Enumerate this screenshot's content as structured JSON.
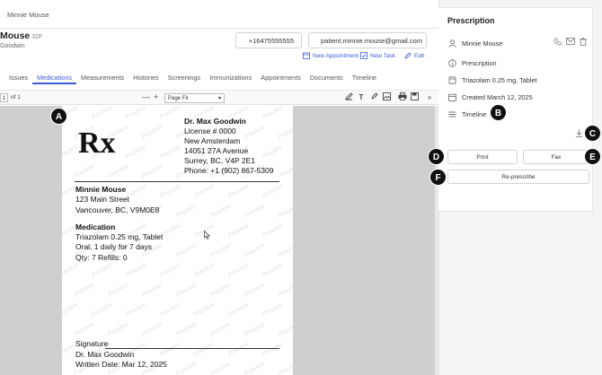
{
  "breadcrumb": "Minnie Mouse",
  "patient": {
    "name": "Mouse",
    "age": "32F",
    "doctor": "Goodwin",
    "phone": "+16475555555",
    "email": "patient.minnie.mouse@gmail.com"
  },
  "actions": {
    "new_appointment": "New Appointment",
    "new_task": "New Task",
    "edit": "Edit"
  },
  "tabs": [
    "Issues",
    "Medications",
    "Measurements",
    "Histories",
    "Screenings",
    "Immunizations",
    "Appointments",
    "Documents",
    "Timeline"
  ],
  "active_tab": "Medications",
  "pdf_toolbar": {
    "page": "1",
    "of": "of 1",
    "zoom_minus": "—",
    "zoom_plus": "+",
    "zoom_value": "Page Fit"
  },
  "document": {
    "rx": "Rx",
    "watermark": "Preview",
    "prescriber": {
      "name": "Dr. Max Goodwin",
      "license": "License # 0000",
      "clinic": "New Amsterdam",
      "address1": "14051 27A Avenue",
      "address2": "Surrey, BC, V4P 2E1",
      "phone": "Phone: +1 (902) 867-5309"
    },
    "patient_name": "Minnie  Mouse",
    "patient_address1": "123 Main Street",
    "patient_address2": "Vancouver, BC, V9M0E8",
    "medication_heading": "Medication",
    "medication_name": "Triazolam 0.25 mg, Tablet",
    "medication_sig": "Oral, 1 daily for 7 days",
    "medication_qty": "Qty: 7 Refills: 0",
    "signature_label": "Signature",
    "signature_name": "Dr. Max Goodwin",
    "written_date": "Written Date: Mar 12, 2025"
  },
  "prescription_panel": {
    "title": "Prescription",
    "patient": "Minnie Mouse",
    "type": "Prescription",
    "medication": "Triazolam 0.25 mg, Tablet",
    "created": "Created March 12, 2025",
    "timeline": "Timeline",
    "print": "Print",
    "fax": "Fax",
    "represcribe": "Re-prescribe"
  },
  "badges": [
    "A",
    "B",
    "C",
    "D",
    "E",
    "F"
  ],
  "colors": {
    "accent": "#3d5bd8",
    "badge": "#111111"
  }
}
